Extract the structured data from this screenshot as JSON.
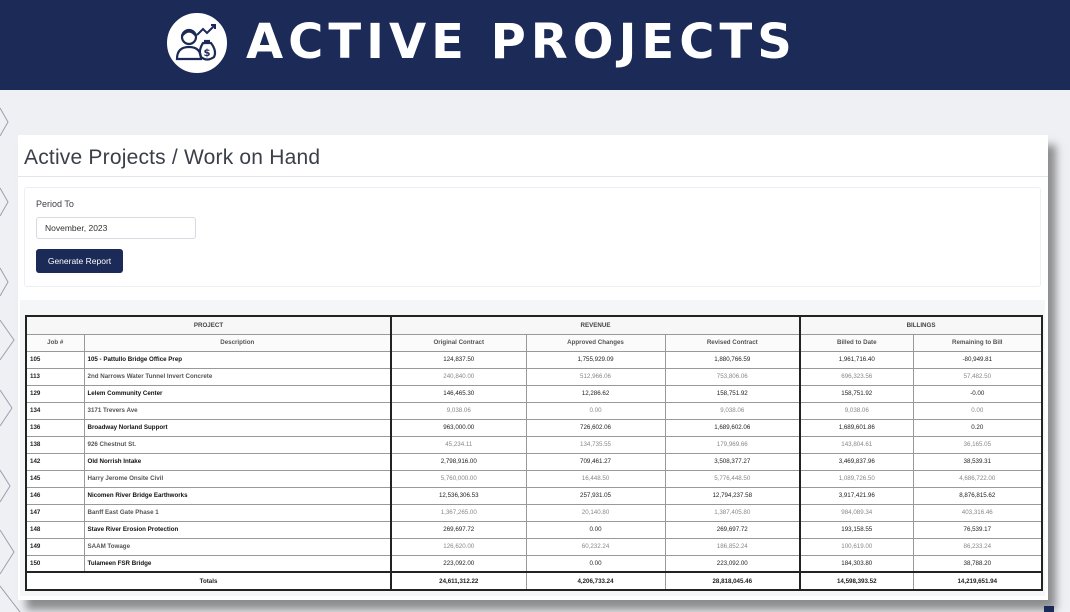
{
  "banner": {
    "title": "ACTIVE PROJECTS",
    "logo_icon": "people-money-icon",
    "background": "#1b2a56"
  },
  "page": {
    "title": "Active Projects / Work on Hand"
  },
  "filter": {
    "period_label": "Period To",
    "period_value": "November, 2023",
    "generate_label": "Generate Report"
  },
  "table": {
    "groups": {
      "project": "PROJECT",
      "revenue": "REVENUE",
      "billings": "BILLINGS"
    },
    "columns": {
      "job": "Job #",
      "description": "Description",
      "original_contract": "Original Contract",
      "approved_changes": "Approved Changes",
      "revised_contract": "Revised Contract",
      "billed_to_date": "Billed to Date",
      "remaining_to_bill": "Remaining to Bill"
    },
    "rows": [
      {
        "job": "105",
        "description": "105 - Pattullo Bridge Office Prep",
        "original": "124,837.50",
        "approved": "1,755,929.09",
        "revised": "1,880,766.59",
        "billed": "1,961,716.40",
        "remaining": "-80,949.81",
        "style": "dark",
        "remaining_negative": true
      },
      {
        "job": "113",
        "description": "2nd Narrows Water Tunnel Invert Concrete",
        "original": "240,840.00",
        "approved": "512,966.06",
        "revised": "753,806.06",
        "billed": "696,323.56",
        "remaining": "57,482.50",
        "style": "light",
        "remaining_negative": false
      },
      {
        "job": "129",
        "description": "Lelem Community Center",
        "original": "146,465.30",
        "approved": "12,286.62",
        "revised": "158,751.92",
        "billed": "158,751.92",
        "remaining": "-0.00",
        "style": "dark",
        "remaining_negative": true
      },
      {
        "job": "134",
        "description": "3171 Trevers Ave",
        "original": "9,038.06",
        "approved": "0.00",
        "revised": "9,038.06",
        "billed": "9,038.06",
        "remaining": "0.00",
        "style": "light",
        "remaining_negative": false
      },
      {
        "job": "136",
        "description": "Broadway Norland Support",
        "original": "963,000.00",
        "approved": "726,602.06",
        "revised": "1,689,602.06",
        "billed": "1,689,601.86",
        "remaining": "0.20",
        "style": "dark",
        "remaining_negative": false
      },
      {
        "job": "138",
        "description": "926 Chestnut St.",
        "original": "45,234.11",
        "approved": "134,735.55",
        "revised": "179,969.66",
        "billed": "143,804.61",
        "remaining": "36,165.05",
        "style": "light",
        "remaining_negative": false
      },
      {
        "job": "142",
        "description": "Old Norrish Intake",
        "original": "2,798,916.00",
        "approved": "709,461.27",
        "revised": "3,508,377.27",
        "billed": "3,469,837.96",
        "remaining": "38,539.31",
        "style": "dark",
        "remaining_negative": false
      },
      {
        "job": "145",
        "description": "Harry Jerome Onsite Civil",
        "original": "5,760,000.00",
        "approved": "16,448.50",
        "revised": "5,776,448.50",
        "billed": "1,089,726.50",
        "remaining": "4,686,722.00",
        "style": "light",
        "remaining_negative": false
      },
      {
        "job": "146",
        "description": "Nicomen River Bridge Earthworks",
        "original": "12,536,306.53",
        "approved": "257,931.05",
        "revised": "12,794,237.58",
        "billed": "3,917,421.96",
        "remaining": "8,876,815.62",
        "style": "dark",
        "remaining_negative": false
      },
      {
        "job": "147",
        "description": "Banff East Gate Phase 1",
        "original": "1,367,265.00",
        "approved": "20,140.80",
        "revised": "1,387,405.80",
        "billed": "984,089.34",
        "remaining": "403,316.46",
        "style": "light",
        "remaining_negative": false
      },
      {
        "job": "148",
        "description": "Stave River Erosion Protection",
        "original": "269,697.72",
        "approved": "0.00",
        "revised": "269,697.72",
        "billed": "193,158.55",
        "remaining": "76,539.17",
        "style": "dark",
        "remaining_negative": false
      },
      {
        "job": "149",
        "description": "SAAM Towage",
        "original": "126,620.00",
        "approved": "60,232.24",
        "revised": "186,852.24",
        "billed": "100,619.00",
        "remaining": "86,233.24",
        "style": "light",
        "remaining_negative": false
      },
      {
        "job": "150",
        "description": "Tulameen FSR Bridge",
        "original": "223,092.00",
        "approved": "0.00",
        "revised": "223,092.00",
        "billed": "184,303.80",
        "remaining": "38,788.20",
        "style": "dark",
        "remaining_negative": false
      }
    ],
    "totals": {
      "label": "Totals",
      "original": "24,611,312.22",
      "approved": "4,206,733.24",
      "revised": "28,818,045.46",
      "billed": "14,598,393.52",
      "remaining": "14,219,651.94"
    }
  },
  "colors": {
    "brand_navy": "#1b2a56",
    "negative_red": "#e06a6a"
  }
}
